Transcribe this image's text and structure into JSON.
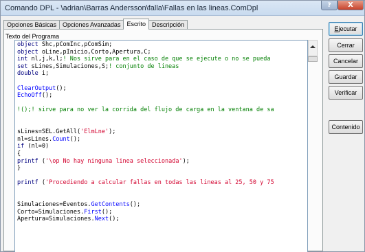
{
  "window": {
    "title": "Comando DPL - \\adrian\\Barras Andersson\\falla\\Fallas en las lineas.ComDpl",
    "help_glyph": "?",
    "close_glyph": "X"
  },
  "tabs": [
    {
      "label": "Opciones Básicas",
      "active": false
    },
    {
      "label": "Opciones Avanzadas",
      "active": false
    },
    {
      "label": "Escrito",
      "active": true
    },
    {
      "label": "Descripción",
      "active": false
    }
  ],
  "editor": {
    "group_label": "Texto del Programa",
    "lines": [
      [
        {
          "t": "object",
          "c": "kw"
        },
        {
          "t": " Shc,pComInc,pComSim;",
          "c": "pl"
        }
      ],
      [
        {
          "t": "object",
          "c": "kw"
        },
        {
          "t": " oLine,pInicio,Corto,Apertura,C;",
          "c": "pl"
        }
      ],
      [
        {
          "t": "int",
          "c": "kw"
        },
        {
          "t": " nl,j,k,l;",
          "c": "pl"
        },
        {
          "t": "! Nos sirve para en el caso de que se ejecute o no se pueda",
          "c": "cm"
        }
      ],
      [
        {
          "t": "set",
          "c": "kw"
        },
        {
          "t": " sLines,Simulaciones,S;",
          "c": "pl"
        },
        {
          "t": "! conjunto de lineas",
          "c": "cm"
        }
      ],
      [
        {
          "t": "double",
          "c": "kw"
        },
        {
          "t": " i;",
          "c": "pl"
        }
      ],
      [],
      [
        {
          "t": "ClearOutput",
          "c": "fn"
        },
        {
          "t": "();",
          "c": "pl"
        }
      ],
      [
        {
          "t": "EchoOff",
          "c": "fn"
        },
        {
          "t": "();",
          "c": "pl"
        }
      ],
      [],
      [
        {
          "t": "!();! sirve para no ver la corrida del flujo de carga en la ventana de sa",
          "c": "cm"
        }
      ],
      [],
      [],
      [
        {
          "t": "sLines=SEL.GetAll(",
          "c": "pl"
        },
        {
          "t": "'ElmLne'",
          "c": "st"
        },
        {
          "t": ");",
          "c": "pl"
        }
      ],
      [
        {
          "t": "nl=sLines.",
          "c": "pl"
        },
        {
          "t": "Count",
          "c": "fn"
        },
        {
          "t": "();",
          "c": "pl"
        }
      ],
      [
        {
          "t": "if",
          "c": "kw"
        },
        {
          "t": " (nl=0)",
          "c": "pl"
        }
      ],
      [
        {
          "t": "{",
          "c": "pl"
        }
      ],
      [
        {
          "t": "printf",
          "c": "kw"
        },
        {
          "t": " (",
          "c": "pl"
        },
        {
          "t": "'\\op No hay ninguna linea seleccionada'",
          "c": "st"
        },
        {
          "t": ");",
          "c": "pl"
        }
      ],
      [
        {
          "t": "}",
          "c": "pl"
        }
      ],
      [],
      [
        {
          "t": "printf",
          "c": "kw"
        },
        {
          "t": " (",
          "c": "pl"
        },
        {
          "t": "'Procediendo a calcular fallas en todas las lineas al 25, 50 y 75",
          "c": "st"
        }
      ],
      [],
      [],
      [
        {
          "t": "Simulaciones=Eventos.",
          "c": "pl"
        },
        {
          "t": "GetContents",
          "c": "fn"
        },
        {
          "t": "();",
          "c": "pl"
        }
      ],
      [
        {
          "t": "Corto=Simulaciones.",
          "c": "pl"
        },
        {
          "t": "First",
          "c": "fn"
        },
        {
          "t": "();",
          "c": "pl"
        }
      ],
      [
        {
          "t": "Apertura=Simulaciones.",
          "c": "pl"
        },
        {
          "t": "Next",
          "c": "fn"
        },
        {
          "t": "();",
          "c": "pl"
        }
      ]
    ]
  },
  "colors": {
    "keyword": "#00007f",
    "comment": "#007f00",
    "function": "#0000ff",
    "string": "#d2002d"
  },
  "buttons": {
    "execute": {
      "prefix": "",
      "underlined": "E",
      "rest": "jecutar"
    },
    "close": "Cerrar",
    "cancel": "Cancelar",
    "save": "Guardar",
    "verify": "Verificar",
    "contents": "Contenido"
  }
}
